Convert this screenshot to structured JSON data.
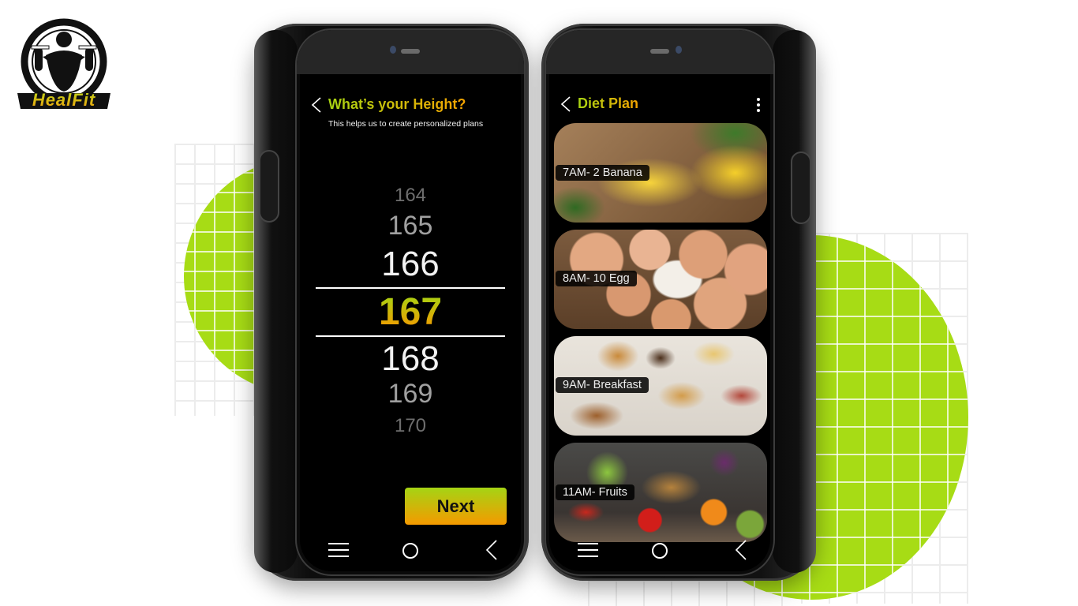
{
  "brand": {
    "name": "HealFit",
    "accent_green": "#a7dc15",
    "accent_orange": "#f59a00"
  },
  "height_screen": {
    "title": "What’s your Height?",
    "subtitle": "This helps us to create personalized plans",
    "picker": {
      "values": [
        "164",
        "165",
        "166",
        "167",
        "168",
        "169",
        "170"
      ],
      "selected": "167"
    },
    "next_label": "Next"
  },
  "diet_screen": {
    "title": "Diet Plan",
    "meals": [
      {
        "label": "7AM- 2 Banana",
        "image": "bananas"
      },
      {
        "label": "8AM- 10 Egg",
        "image": "eggs"
      },
      {
        "label": "9AM- Breakfast",
        "image": "breakfast-spread"
      },
      {
        "label": "11AM- Fruits",
        "image": "fruit-basket"
      }
    ]
  },
  "navbar": {
    "icons": [
      "menu-icon",
      "home-icon",
      "back-icon"
    ]
  }
}
